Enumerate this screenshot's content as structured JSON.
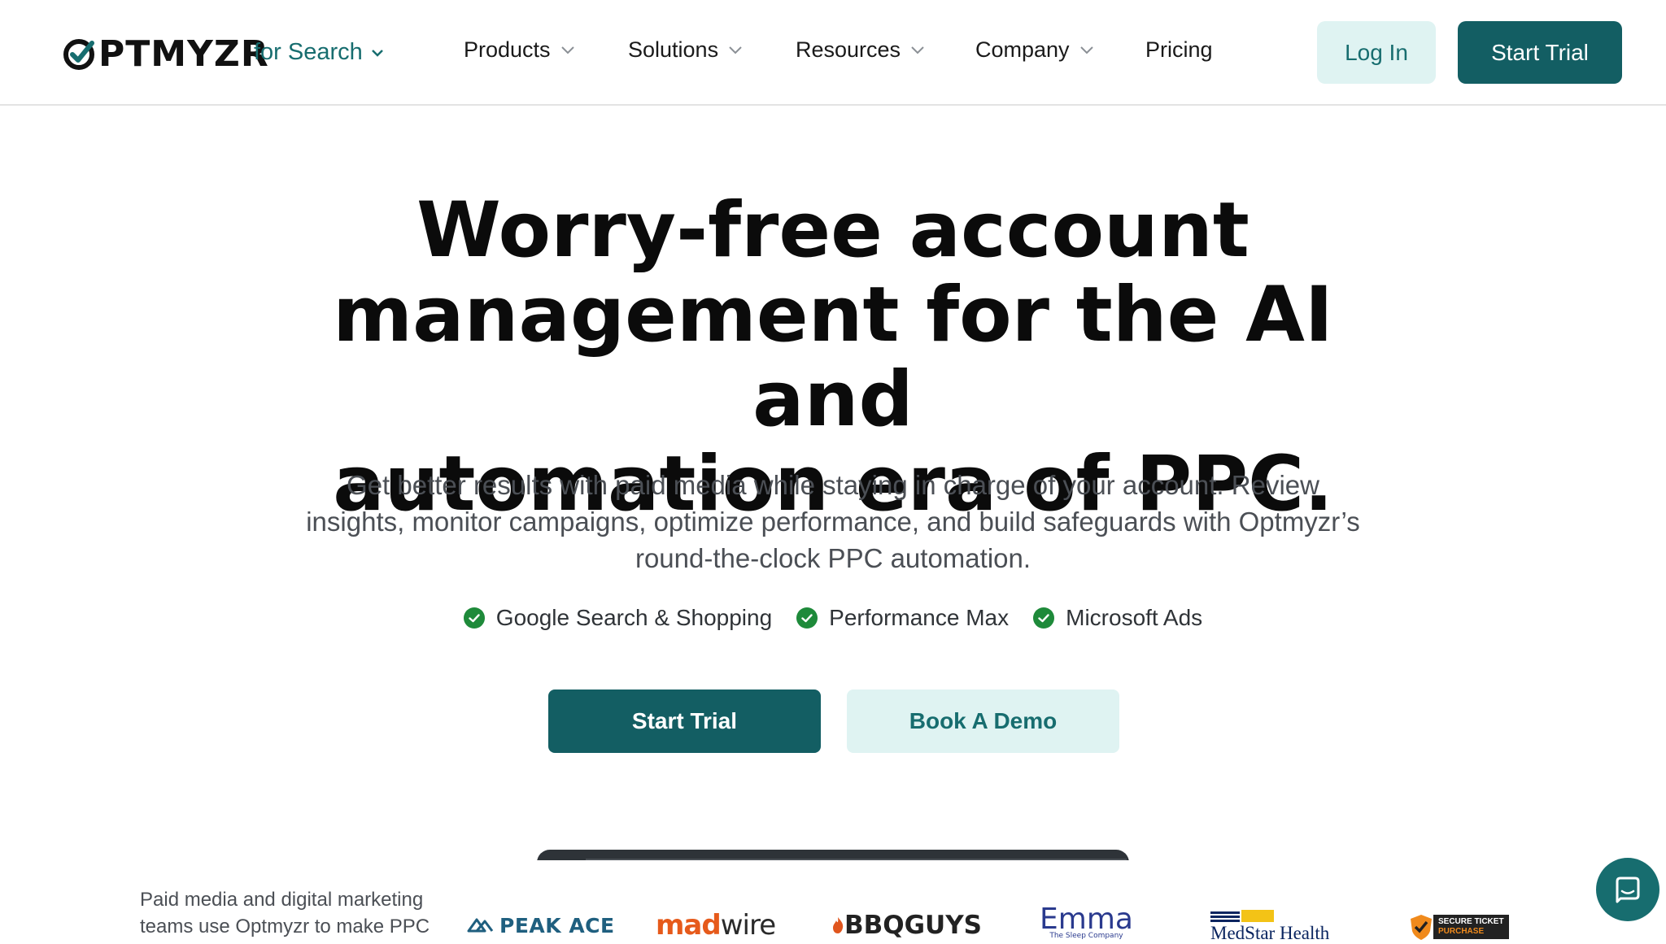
{
  "header": {
    "logo_text": "PTMYZR",
    "logo_product": "for Search",
    "nav": [
      {
        "label": "Products"
      },
      {
        "label": "Solutions"
      },
      {
        "label": "Resources"
      },
      {
        "label": "Company"
      },
      {
        "label": "Pricing"
      }
    ],
    "login_label": "Log In",
    "trial_label": "Start Trial"
  },
  "hero": {
    "title_lines": [
      "Worry-free account",
      "management for the AI and",
      "automation era of PPC."
    ],
    "subtitle_lines": [
      "Get better results with paid media while staying in charge of your account. Review",
      "insights, monitor campaigns, optimize performance, and build safeguards with Optmyzr’s",
      "round-the-clock PPC automation."
    ],
    "features": [
      "Google Search & Shopping",
      "Performance Max",
      "Microsoft Ads"
    ],
    "cta_trial": "Start Trial",
    "cta_demo": "Book A Demo"
  },
  "trust": {
    "text": "Paid media and digital marketing teams use Optmyzr to make PPC",
    "logos": {
      "peak_ace": "PEAK ACE",
      "madwire_a": "mad",
      "madwire_b": "wire",
      "bbqguys": "BBQGUYS",
      "emma": "Emma",
      "emma_tag": "The Sleep Company",
      "medstar": "MedStar Health",
      "secure_1": "SECURE TICKET",
      "secure_2": "PURCHASE"
    }
  },
  "colors": {
    "brand_teal": "#135e63",
    "brand_teal_light": "#dff3f2",
    "check_green": "#1e8a3a"
  },
  "icons": [
    "chevron-down-icon",
    "check-circle-icon",
    "chat-icon"
  ]
}
